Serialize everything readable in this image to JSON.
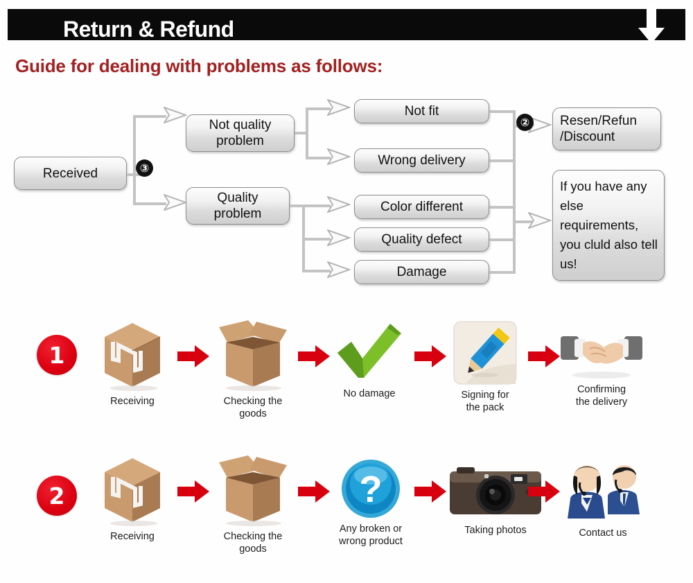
{
  "banner": {
    "title": "Return & Refund",
    "arrow_icon": "arrow-down-icon"
  },
  "sub_heading": "Guide for dealing with problems as follows:",
  "colors": {
    "banner_bg": "#0a0a0a",
    "heading_red": "#a32020",
    "step_red": "#dc0010",
    "box_border": "#8d8d8d",
    "connector": "#c3c3c3"
  },
  "flowchart": {
    "badges": [
      {
        "label": "③",
        "name": "flow-badge-3"
      },
      {
        "label": "②",
        "name": "flow-badge-2"
      }
    ],
    "nodes": {
      "received": "Received",
      "not_quality_problem": "Not quality\nproblem",
      "quality_problem": "Quality\nproblem",
      "not_fit": "Not fit",
      "wrong_delivery": "Wrong delivery",
      "color_different": "Color different",
      "quality_defect": "Quality defect",
      "damage": "Damage",
      "resend_refund_discount": "Resen/Refun\n/Discount",
      "any_else": "If you have any else requirements, you cluld also tell us!"
    }
  },
  "process_rows": [
    {
      "number": "1",
      "steps": [
        {
          "icon": "sealed-parcel-icon",
          "caption": "Receiving"
        },
        {
          "icon": "open-box-icon",
          "caption": "Checking the\ngoods"
        },
        {
          "icon": "green-check-icon",
          "caption": "No damage"
        },
        {
          "icon": "pencil-signing-icon",
          "caption": "Signing for\nthe pack"
        },
        {
          "icon": "handshake-icon",
          "caption": "Confirming\nthe delivery"
        }
      ]
    },
    {
      "number": "2",
      "steps": [
        {
          "icon": "sealed-parcel-icon",
          "caption": "Receiving"
        },
        {
          "icon": "open-box-icon",
          "caption": "Checking the\ngoods"
        },
        {
          "icon": "question-mark-icon",
          "caption": "Any broken or\nwrong product"
        },
        {
          "icon": "camera-icon",
          "caption": "Taking photos"
        },
        {
          "icon": "support-agents-icon",
          "caption": "Contact us"
        }
      ]
    }
  ]
}
